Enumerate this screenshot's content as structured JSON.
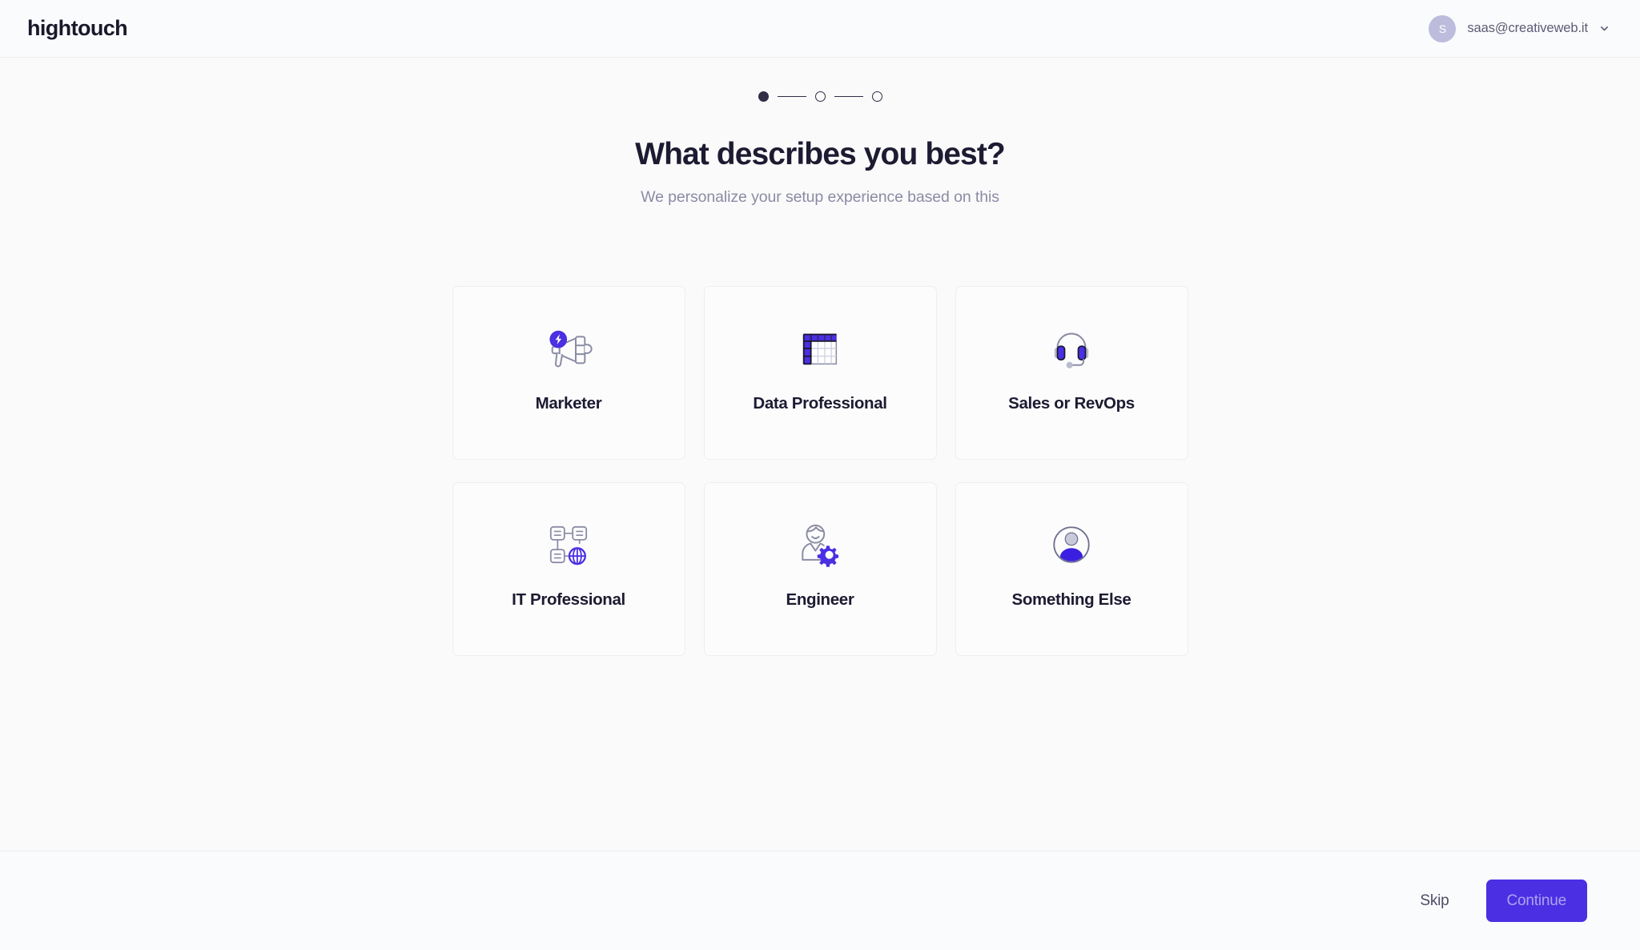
{
  "header": {
    "brand": "hightouch",
    "user": {
      "avatar_initial": "S",
      "email": "saas@creativeweb.it",
      "chevron_icon": "chevron-down-icon"
    }
  },
  "stepper": {
    "total_steps": 3,
    "current_step": 1,
    "steps": [
      {
        "index": 1,
        "state": "active"
      },
      {
        "index": 2,
        "state": "upcoming"
      },
      {
        "index": 3,
        "state": "upcoming"
      }
    ]
  },
  "main": {
    "headline": "What describes you best?",
    "subhead": "We personalize your setup experience based on this",
    "options": [
      {
        "id": "marketer",
        "label": "Marketer",
        "icon": "megaphone-bolt-icon",
        "selected": false
      },
      {
        "id": "data-professional",
        "label": "Data Professional",
        "icon": "table-grid-icon",
        "selected": false
      },
      {
        "id": "sales-revops",
        "label": "Sales or RevOps",
        "icon": "headset-icon",
        "selected": false
      },
      {
        "id": "it-professional",
        "label": "IT Professional",
        "icon": "network-globe-icon",
        "selected": false
      },
      {
        "id": "engineer",
        "label": "Engineer",
        "icon": "person-gear-icon",
        "selected": false
      },
      {
        "id": "something-else",
        "label": "Something Else",
        "icon": "user-avatar-icon",
        "selected": false
      }
    ]
  },
  "footer": {
    "skip_label": "Skip",
    "continue_label": "Continue",
    "continue_disabled": true
  },
  "colors": {
    "accent_purple": "#4a2fe3",
    "icon_gray": "#8a8ca5",
    "text_dark": "#1c1b31",
    "text_muted": "#8b8ba3",
    "page_bg": "#fafafb",
    "card_border": "#eceef1",
    "avatar_bg": "#bdbcdd"
  }
}
